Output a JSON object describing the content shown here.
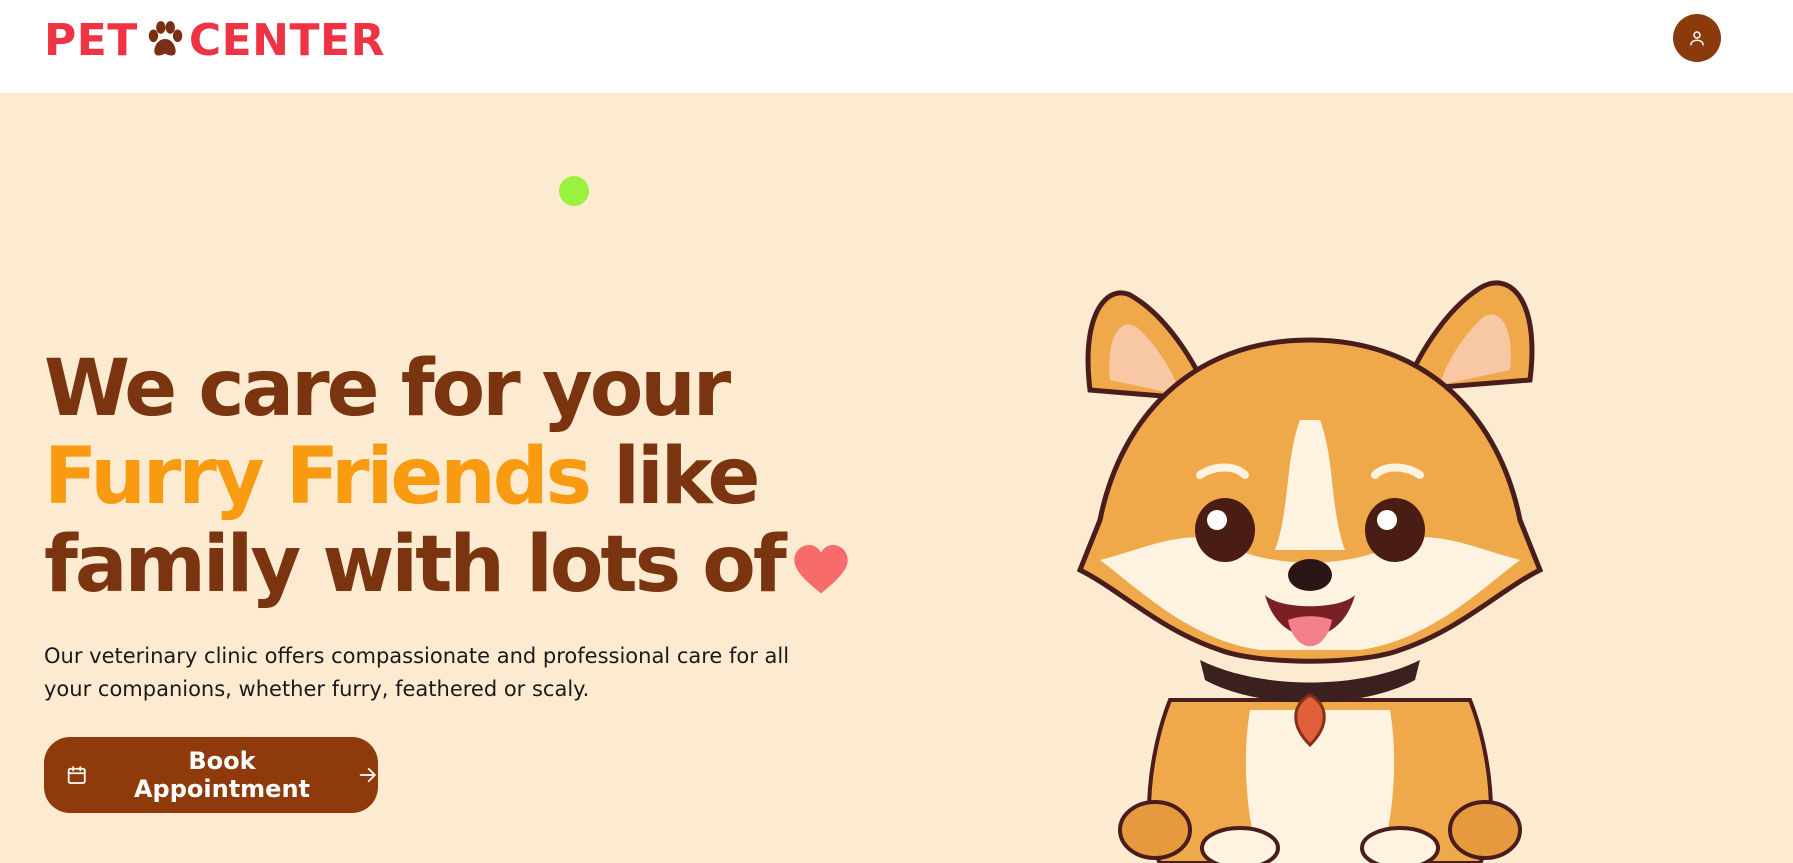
{
  "brand": {
    "name_part1": "PET",
    "name_part2": "CENTER",
    "logo_icon": "paw-icon",
    "color": "#ee3344"
  },
  "header": {
    "user_icon": "user-icon",
    "user_button_color": "#8b3a0b"
  },
  "hero": {
    "headline_line1": "We care for your",
    "headline_accent": "Furry Friends",
    "headline_line2_rest": "like",
    "headline_line3": "family with lots of",
    "heart_icon": "heart-icon",
    "description": "Our veterinary clinic offers compassionate and professional care for all your companions, whether furry, feathered or scaly.",
    "cta_label": "Book Appointment",
    "cta_icon_left": "calendar-icon",
    "cta_icon_right": "arrow-right-icon",
    "illustration": "corgi-puppy-illustration"
  },
  "colors": {
    "background": "#fdebd1",
    "headline": "#7a3510",
    "accent": "#f89b11",
    "heart": "#f76b6b",
    "button": "#8f3a0a",
    "dot": "#9af13e"
  }
}
